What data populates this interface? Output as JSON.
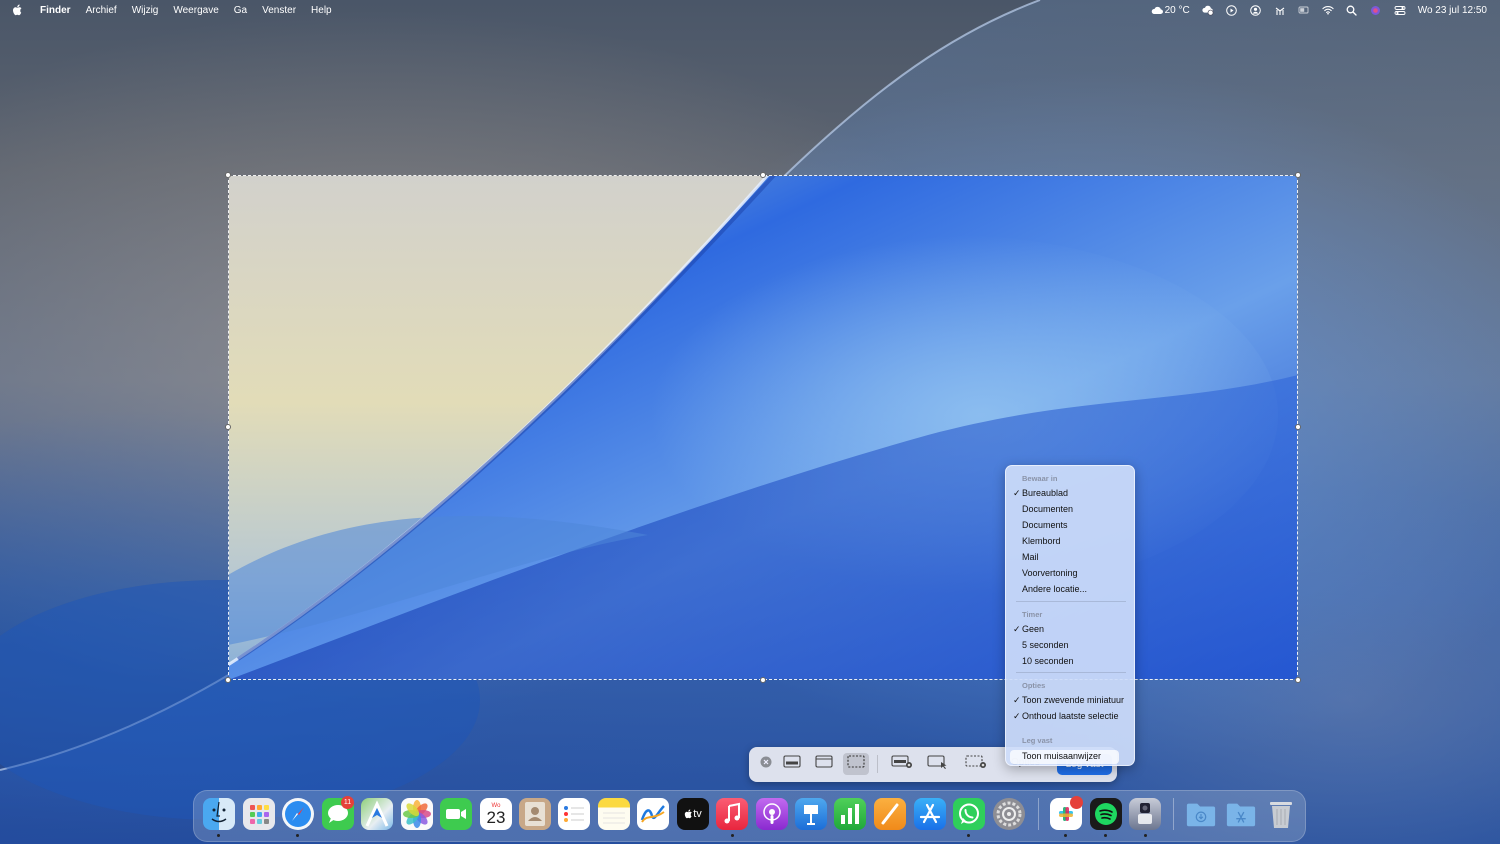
{
  "menubar": {
    "app_name": "Finder",
    "items": [
      "Archief",
      "Wijzig",
      "Weergave",
      "Ga",
      "Venster",
      "Help"
    ],
    "weather": "20 °C",
    "datetime": "Wo 23 jul 12:50"
  },
  "toolbar": {
    "options_label": "Opties",
    "capture_label": "Leg vast",
    "active_mode": "capture-selection"
  },
  "dropdown": {
    "save_header": "Bewaar in",
    "save_items": [
      {
        "label": "Bureaublad",
        "checked": true
      },
      {
        "label": "Documenten",
        "checked": false
      },
      {
        "label": "Documents",
        "checked": false
      },
      {
        "label": "Klembord",
        "checked": false
      },
      {
        "label": "Mail",
        "checked": false
      },
      {
        "label": "Voorvertoning",
        "checked": false
      },
      {
        "label": "Andere locatie...",
        "checked": false
      }
    ],
    "timer_header": "Timer",
    "timer_items": [
      {
        "label": "Geen",
        "checked": true
      },
      {
        "label": "5 seconden",
        "checked": false
      },
      {
        "label": "10 seconden",
        "checked": false
      }
    ],
    "options_header": "Opties",
    "options_items": [
      {
        "label": "Toon zwevende miniatuur",
        "checked": true
      },
      {
        "label": "Onthoud laatste selectie",
        "checked": true
      }
    ],
    "capture_header": "Leg vast",
    "capture_items": [
      {
        "label": "Toon muisaanwijzer",
        "checked": false,
        "highlighted": true
      }
    ]
  },
  "dock": {
    "messages_badge": "11",
    "calendar_month": "Wo",
    "calendar_day": "23",
    "appletv_label": "tv"
  },
  "colors": {
    "accent": "#1f6ee8",
    "badge": "#e5403a"
  }
}
